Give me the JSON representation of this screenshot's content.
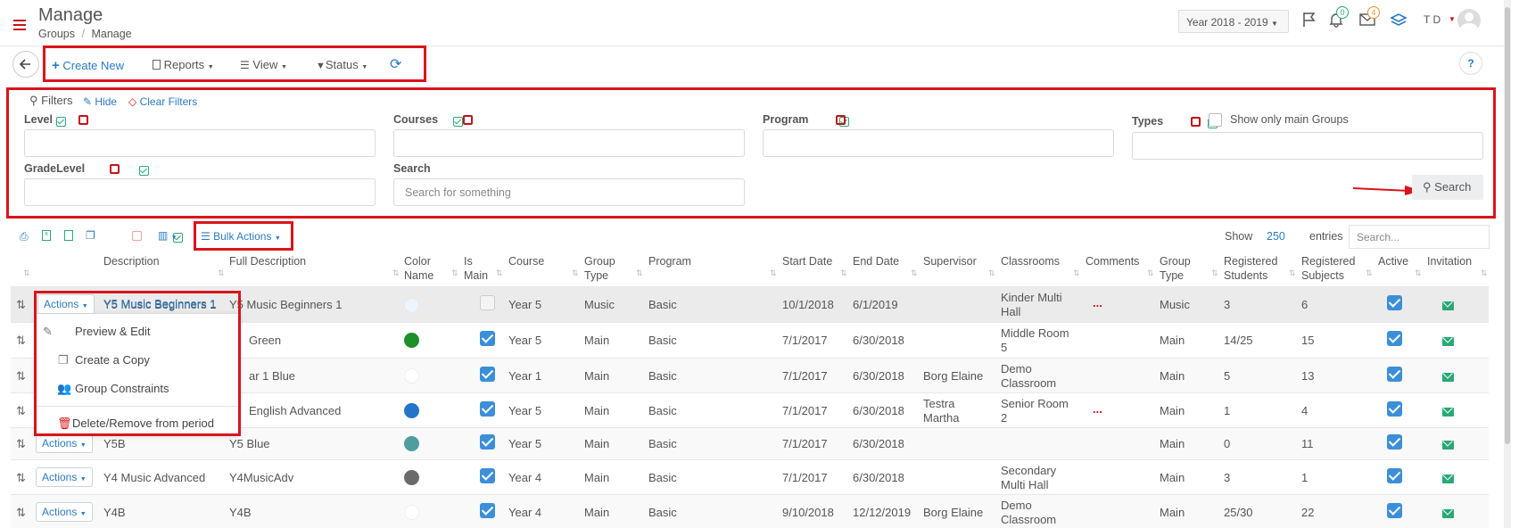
{
  "header": {
    "title": "Manage",
    "breadcrumb": [
      "Groups",
      "Manage"
    ],
    "year_select": "Year 2018 - 2019",
    "bell_count": "0",
    "mail_count": "4",
    "user_initials": "T D"
  },
  "toolbar": {
    "create_new": "Create New",
    "reports": "Reports",
    "view": "View",
    "status": "Status",
    "help": "?"
  },
  "filters": {
    "title": "Filters",
    "hide": "Hide",
    "clear": "Clear Filters",
    "level": "Level",
    "courses": "Courses",
    "program": "Program",
    "types": "Types",
    "show_main": "Show only main Groups",
    "grade_level": "GradeLevel",
    "search_label": "Search",
    "search_placeholder": "Search for something",
    "search_button": "Search"
  },
  "table_toolbar": {
    "bulk_actions": "Bulk Actions",
    "show": "Show",
    "entries_count": "250",
    "entries": "entries",
    "search_placeholder": "Search..."
  },
  "columns": {
    "description": "Description",
    "full_description": "Full Description",
    "color_name": [
      "Color",
      "Name"
    ],
    "is_main": [
      "Is",
      "Main"
    ],
    "course": "Course",
    "group_type": [
      "Group",
      "Type"
    ],
    "program": "Program",
    "start_date": "Start Date",
    "end_date": "End Date",
    "supervisor": "Supervisor",
    "classrooms": "Classrooms",
    "comments": "Comments",
    "group_type2": [
      "Group",
      "Type"
    ],
    "registered_students": [
      "Registered",
      "Students"
    ],
    "registered_subjects": [
      "Registered",
      "Subjects"
    ],
    "active": "Active",
    "invitation": "Invitation"
  },
  "actions_label": "Actions",
  "rows": [
    {
      "desc": "Y5 Music Beginners 1",
      "full": "Y5 Music Beginners 1",
      "color": "#eef4fb",
      "main": false,
      "course": "Year 5",
      "gtype": "Music",
      "program": "Basic",
      "start": "10/1/2018",
      "end": "6/1/2019",
      "supervisor": [
        "",
        ""
      ],
      "classroom": [
        "Kinder Multi",
        "Hall"
      ],
      "comments": "...",
      "gtype2": "Music",
      "students": "3",
      "subjects": "6"
    },
    {
      "desc": "",
      "full": "Green",
      "color": "#1e8f2a",
      "main": true,
      "course": "Year 5",
      "gtype": "Main",
      "program": "Basic",
      "start": "7/1/2017",
      "end": "6/30/2018",
      "supervisor": [
        "",
        ""
      ],
      "classroom": [
        "Middle Room",
        "5"
      ],
      "comments": "",
      "gtype2": "Main",
      "students": "14/25",
      "subjects": "15"
    },
    {
      "desc": "",
      "full": "ar 1 Blue",
      "color": "#ffffff",
      "main": true,
      "course": "Year 1",
      "gtype": "Main",
      "program": "Basic",
      "start": "7/1/2017",
      "end": "6/30/2018",
      "supervisor": [
        "Borg Elaine",
        ""
      ],
      "classroom": [
        "Demo",
        "Classroom"
      ],
      "comments": "",
      "gtype2": "Main",
      "students": "5",
      "subjects": "13"
    },
    {
      "desc": "",
      "full": "English Advanced",
      "color": "#2474c8",
      "main": true,
      "course": "Year 5",
      "gtype": "Main",
      "program": "Basic",
      "start": "7/1/2017",
      "end": "6/30/2018",
      "supervisor": [
        "Testra",
        "Martha"
      ],
      "classroom": [
        "Senior Room",
        "2"
      ],
      "comments": "...",
      "gtype2": "Main",
      "students": "1",
      "subjects": "4"
    },
    {
      "desc": "Y5B",
      "full": "Y5 Blue",
      "color": "#4f9e9e",
      "main": true,
      "course": "Year 5",
      "gtype": "Main",
      "program": "Basic",
      "start": "7/1/2017",
      "end": "6/30/2018",
      "supervisor": [
        "",
        ""
      ],
      "classroom": [
        "",
        ""
      ],
      "comments": "",
      "gtype2": "Main",
      "students": "0",
      "subjects": "11"
    },
    {
      "desc": "Y4 Music Advanced",
      "full": "Y4MusicAdv",
      "color": "#6b6b6b",
      "main": true,
      "course": "Year 4",
      "gtype": "Main",
      "program": "Basic",
      "start": "7/1/2017",
      "end": "6/30/2018",
      "supervisor": [
        "",
        ""
      ],
      "classroom": [
        "Secondary",
        "Multi Hall"
      ],
      "comments": "",
      "gtype2": "Main",
      "students": "3",
      "subjects": "1"
    },
    {
      "desc": "Y4B",
      "full": "Y4B",
      "color": "#ffffff",
      "main": true,
      "course": "Year 4",
      "gtype": "Main",
      "program": "Basic",
      "start": "9/10/2018",
      "end": "12/12/2019",
      "supervisor": [
        "Borg Elaine",
        ""
      ],
      "classroom": [
        "Demo",
        "Classroom"
      ],
      "comments": "",
      "gtype2": "Main",
      "students": "25/30",
      "subjects": "22"
    }
  ],
  "dropdown": {
    "preview_edit": "Preview & Edit",
    "create_copy": "Create a Copy",
    "group_constraints": "Group Constraints",
    "delete": "Delete/Remove from period"
  }
}
